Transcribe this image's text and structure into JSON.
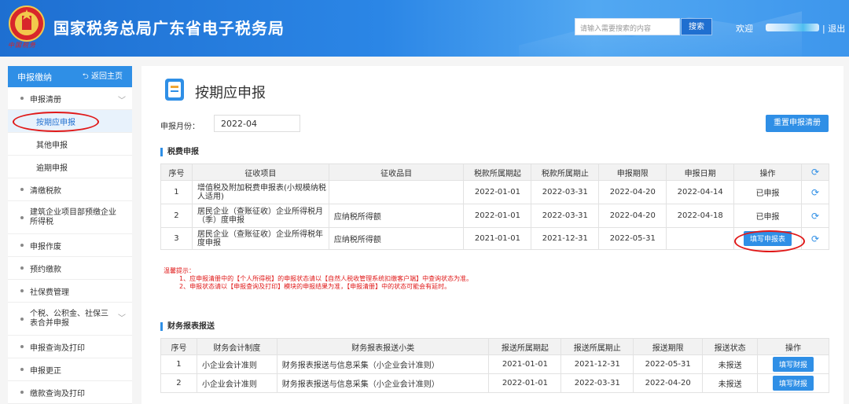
{
  "header": {
    "title": "国家税务总局广东省电子税务局",
    "emblem_text": "中国税务",
    "search_placeholder": "请输入需要搜索的内容",
    "search_button": "搜索",
    "welcome": "欢迎",
    "logout": "| 退出"
  },
  "sidebar": {
    "header_title": "申报缴纳",
    "back_label": "返回主页",
    "items": [
      {
        "label": "申报清册"
      },
      {
        "label": "清缴税款"
      },
      {
        "label": "建筑企业项目部预缴企业所得税"
      },
      {
        "label": "申报作废"
      },
      {
        "label": "预约缴款"
      },
      {
        "label": "社保费管理"
      },
      {
        "label": "个税、公积金、社保三表合并申报"
      },
      {
        "label": "申报查询及打印"
      },
      {
        "label": "申报更正"
      },
      {
        "label": "缴款查询及打印"
      }
    ],
    "subitems": [
      {
        "label": "按期应申报"
      },
      {
        "label": "其他申报"
      },
      {
        "label": "逾期申报"
      }
    ]
  },
  "main": {
    "title": "按期应申报",
    "month_label": "申报月份：",
    "month_value": "2022-04",
    "reset_button": "重置申报清册",
    "tax_section_title": "税费申报",
    "tax_headers": [
      "序号",
      "征收项目",
      "征收品目",
      "税款所属期起",
      "税款所属期止",
      "申报期限",
      "申报日期",
      "操作"
    ],
    "tax_rows": [
      {
        "no": "1",
        "item": "增值税及附加税费申报表(小规模纳税人适用)",
        "sub": "",
        "start": "2022-01-01",
        "end": "2022-03-31",
        "deadline": "2022-04-20",
        "date": "2022-04-14",
        "op": "已申报"
      },
      {
        "no": "2",
        "item": "居民企业（查账征收）企业所得税月（季）度申报",
        "sub": "应纳税所得额",
        "start": "2022-01-01",
        "end": "2022-03-31",
        "deadline": "2022-04-20",
        "date": "2022-04-18",
        "op": "已申报"
      },
      {
        "no": "3",
        "item": "居民企业（查账征收）企业所得税年度申报",
        "sub": "应纳税所得额",
        "start": "2021-01-01",
        "end": "2021-12-31",
        "deadline": "2022-05-31",
        "date": "",
        "op": "填写申报表"
      }
    ],
    "notice_title": "温馨提示：",
    "notice_line1": "1、应申报清册中的【个人所得税】的申报状态请以【自然人税收管理系统扣缴客户端】中查询状态为准。",
    "notice_line2": "2、申报状态请以【申报查询及打印】模块的申报结果为准，【申报清册】中的状态可能会有延时。",
    "fin_section_title": "财务报表报送",
    "fin_headers": [
      "序号",
      "财务会计制度",
      "财务报表报送小类",
      "报送所属期起",
      "报送所属期止",
      "报送期限",
      "报送状态",
      "操作"
    ],
    "fin_rows": [
      {
        "no": "1",
        "system": "小企业会计准则",
        "type": "财务报表报送与信息采集（小企业会计准则）",
        "start": "2021-01-01",
        "end": "2021-12-31",
        "deadline": "2022-05-31",
        "status": "未报送",
        "op": "填写财报"
      },
      {
        "no": "2",
        "system": "小企业会计准则",
        "type": "财务报表报送与信息采集（小企业会计准则）",
        "start": "2022-01-01",
        "end": "2022-03-31",
        "deadline": "2022-04-20",
        "status": "未报送",
        "op": "填写财报"
      }
    ]
  },
  "colors": {
    "primary": "#2f8fe6",
    "header": "#1e6fd1",
    "highlight": "#e01818"
  },
  "icons": [
    "emblem-icon",
    "back-arrow-icon",
    "chevron-down-icon",
    "refresh-icon",
    "page-icon"
  ]
}
